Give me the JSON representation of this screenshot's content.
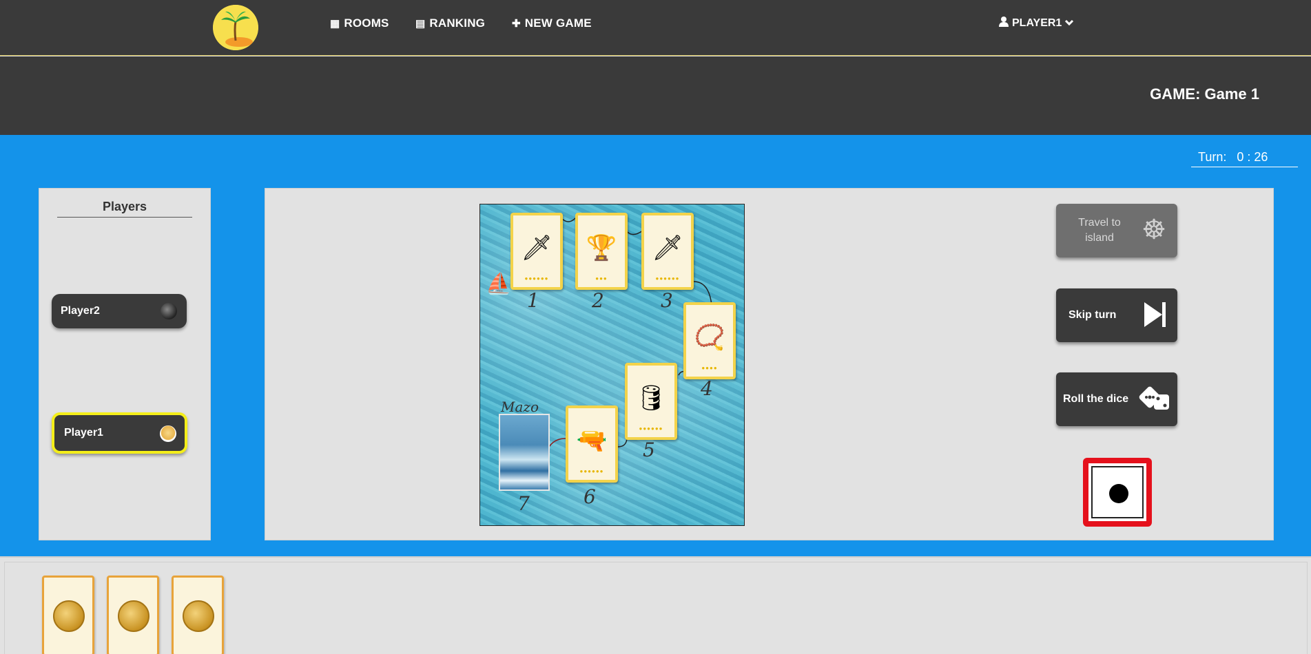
{
  "nav": {
    "rooms_label": "ROOMS",
    "ranking_label": "RANKING",
    "new_game_label": "NEW GAME",
    "user_label": "PLAYER1"
  },
  "header": {
    "game_title": "GAME: Game 1"
  },
  "turn": {
    "label": "Turn:",
    "time": "0 : 26"
  },
  "players_panel": {
    "title": "Players",
    "players": [
      {
        "name": "Player2",
        "active": false
      },
      {
        "name": "Player1",
        "active": true
      }
    ]
  },
  "board": {
    "cards": [
      {
        "number": "1",
        "item": "sword-icon"
      },
      {
        "number": "2",
        "item": "goblet-icon"
      },
      {
        "number": "3",
        "item": "sword-icon"
      },
      {
        "number": "4",
        "item": "necklace-icon"
      },
      {
        "number": "5",
        "item": "rum-barrel-icon"
      },
      {
        "number": "6",
        "item": "pistol-icon"
      },
      {
        "number": "7",
        "item": "deck"
      }
    ],
    "deck_label": "Mazo"
  },
  "actions": {
    "travel_label": "Travel to island",
    "skip_label": "Skip turn",
    "roll_label": "Roll the dice"
  },
  "dice": {
    "value": 1
  },
  "hand": {
    "cards": [
      "coin",
      "coin",
      "coin"
    ]
  },
  "colors": {
    "accent_blue": "#1493ea",
    "dark": "#3a3a3a",
    "active_player_border": "#f4ee1a",
    "dice_border": "#e5111c"
  }
}
